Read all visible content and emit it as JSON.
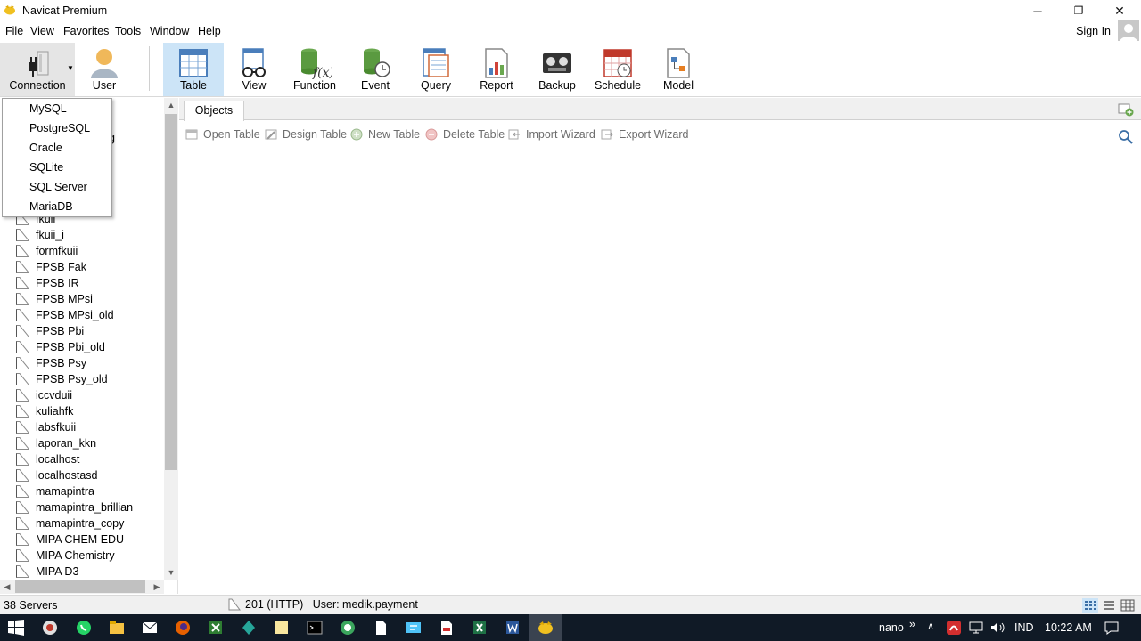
{
  "window": {
    "title": "Navicat Premium",
    "controls": {
      "minimize": "─",
      "restore": "❐",
      "close": "✕"
    }
  },
  "menubar": {
    "items": [
      "File",
      "View",
      "Favorites",
      "Tools",
      "Window",
      "Help"
    ],
    "sign_in": "Sign In"
  },
  "toolbar": {
    "tools": [
      {
        "label": "Connection",
        "icon": "plug-icon"
      },
      {
        "label": "User",
        "icon": "user-icon"
      },
      {
        "label": "Table",
        "icon": "table-icon"
      },
      {
        "label": "View",
        "icon": "glasses-icon"
      },
      {
        "label": "Function",
        "icon": "function-icon"
      },
      {
        "label": "Event",
        "icon": "event-icon"
      },
      {
        "label": "Query",
        "icon": "query-icon"
      },
      {
        "label": "Report",
        "icon": "report-icon"
      },
      {
        "label": "Backup",
        "icon": "backup-icon"
      },
      {
        "label": "Schedule",
        "icon": "schedule-icon"
      },
      {
        "label": "Model",
        "icon": "model-icon"
      }
    ],
    "active": "Table"
  },
  "connection_dropdown": {
    "items": [
      "MySQL",
      "PostgreSQL",
      "Oracle",
      "SQLite",
      "SQL Server",
      "MariaDB"
    ]
  },
  "connections": {
    "items": [
      "fkuii",
      "fkuii_i",
      "formfkuii",
      "FPSB Fak",
      "FPSB IR",
      "FPSB MPsi",
      "FPSB MPsi_old",
      "FPSB Pbi",
      "FPSB Pbi_old",
      "FPSB Psy",
      "FPSB Psy_old",
      "iccvduii",
      "kuliahfk",
      "labsfkuii",
      "laporan_kkn",
      "localhost",
      "localhostasd",
      "mamapintra",
      "mamapintra_brillian",
      "mamapintra_copy",
      "MIPA CHEM EDU",
      "MIPA Chemistry",
      "MIPA D3"
    ],
    "partial_label": "g"
  },
  "objects_panel": {
    "tab": "Objects",
    "actions": [
      "Open Table",
      "Design Table",
      "New Table",
      "Delete Table",
      "Import Wizard",
      "Export Wizard"
    ]
  },
  "statusbar": {
    "count": "38 Servers",
    "connection": "201 (HTTP)",
    "user": "User: medik.payment"
  },
  "taskbar": {
    "user": "nano",
    "chevron": "»",
    "lang": "IND",
    "time": "10:22 AM"
  },
  "colors": {
    "active_tool_bg": "#cce4f7",
    "taskbar_bg": "#101a26",
    "disabled_text": "#6d6d6d"
  }
}
